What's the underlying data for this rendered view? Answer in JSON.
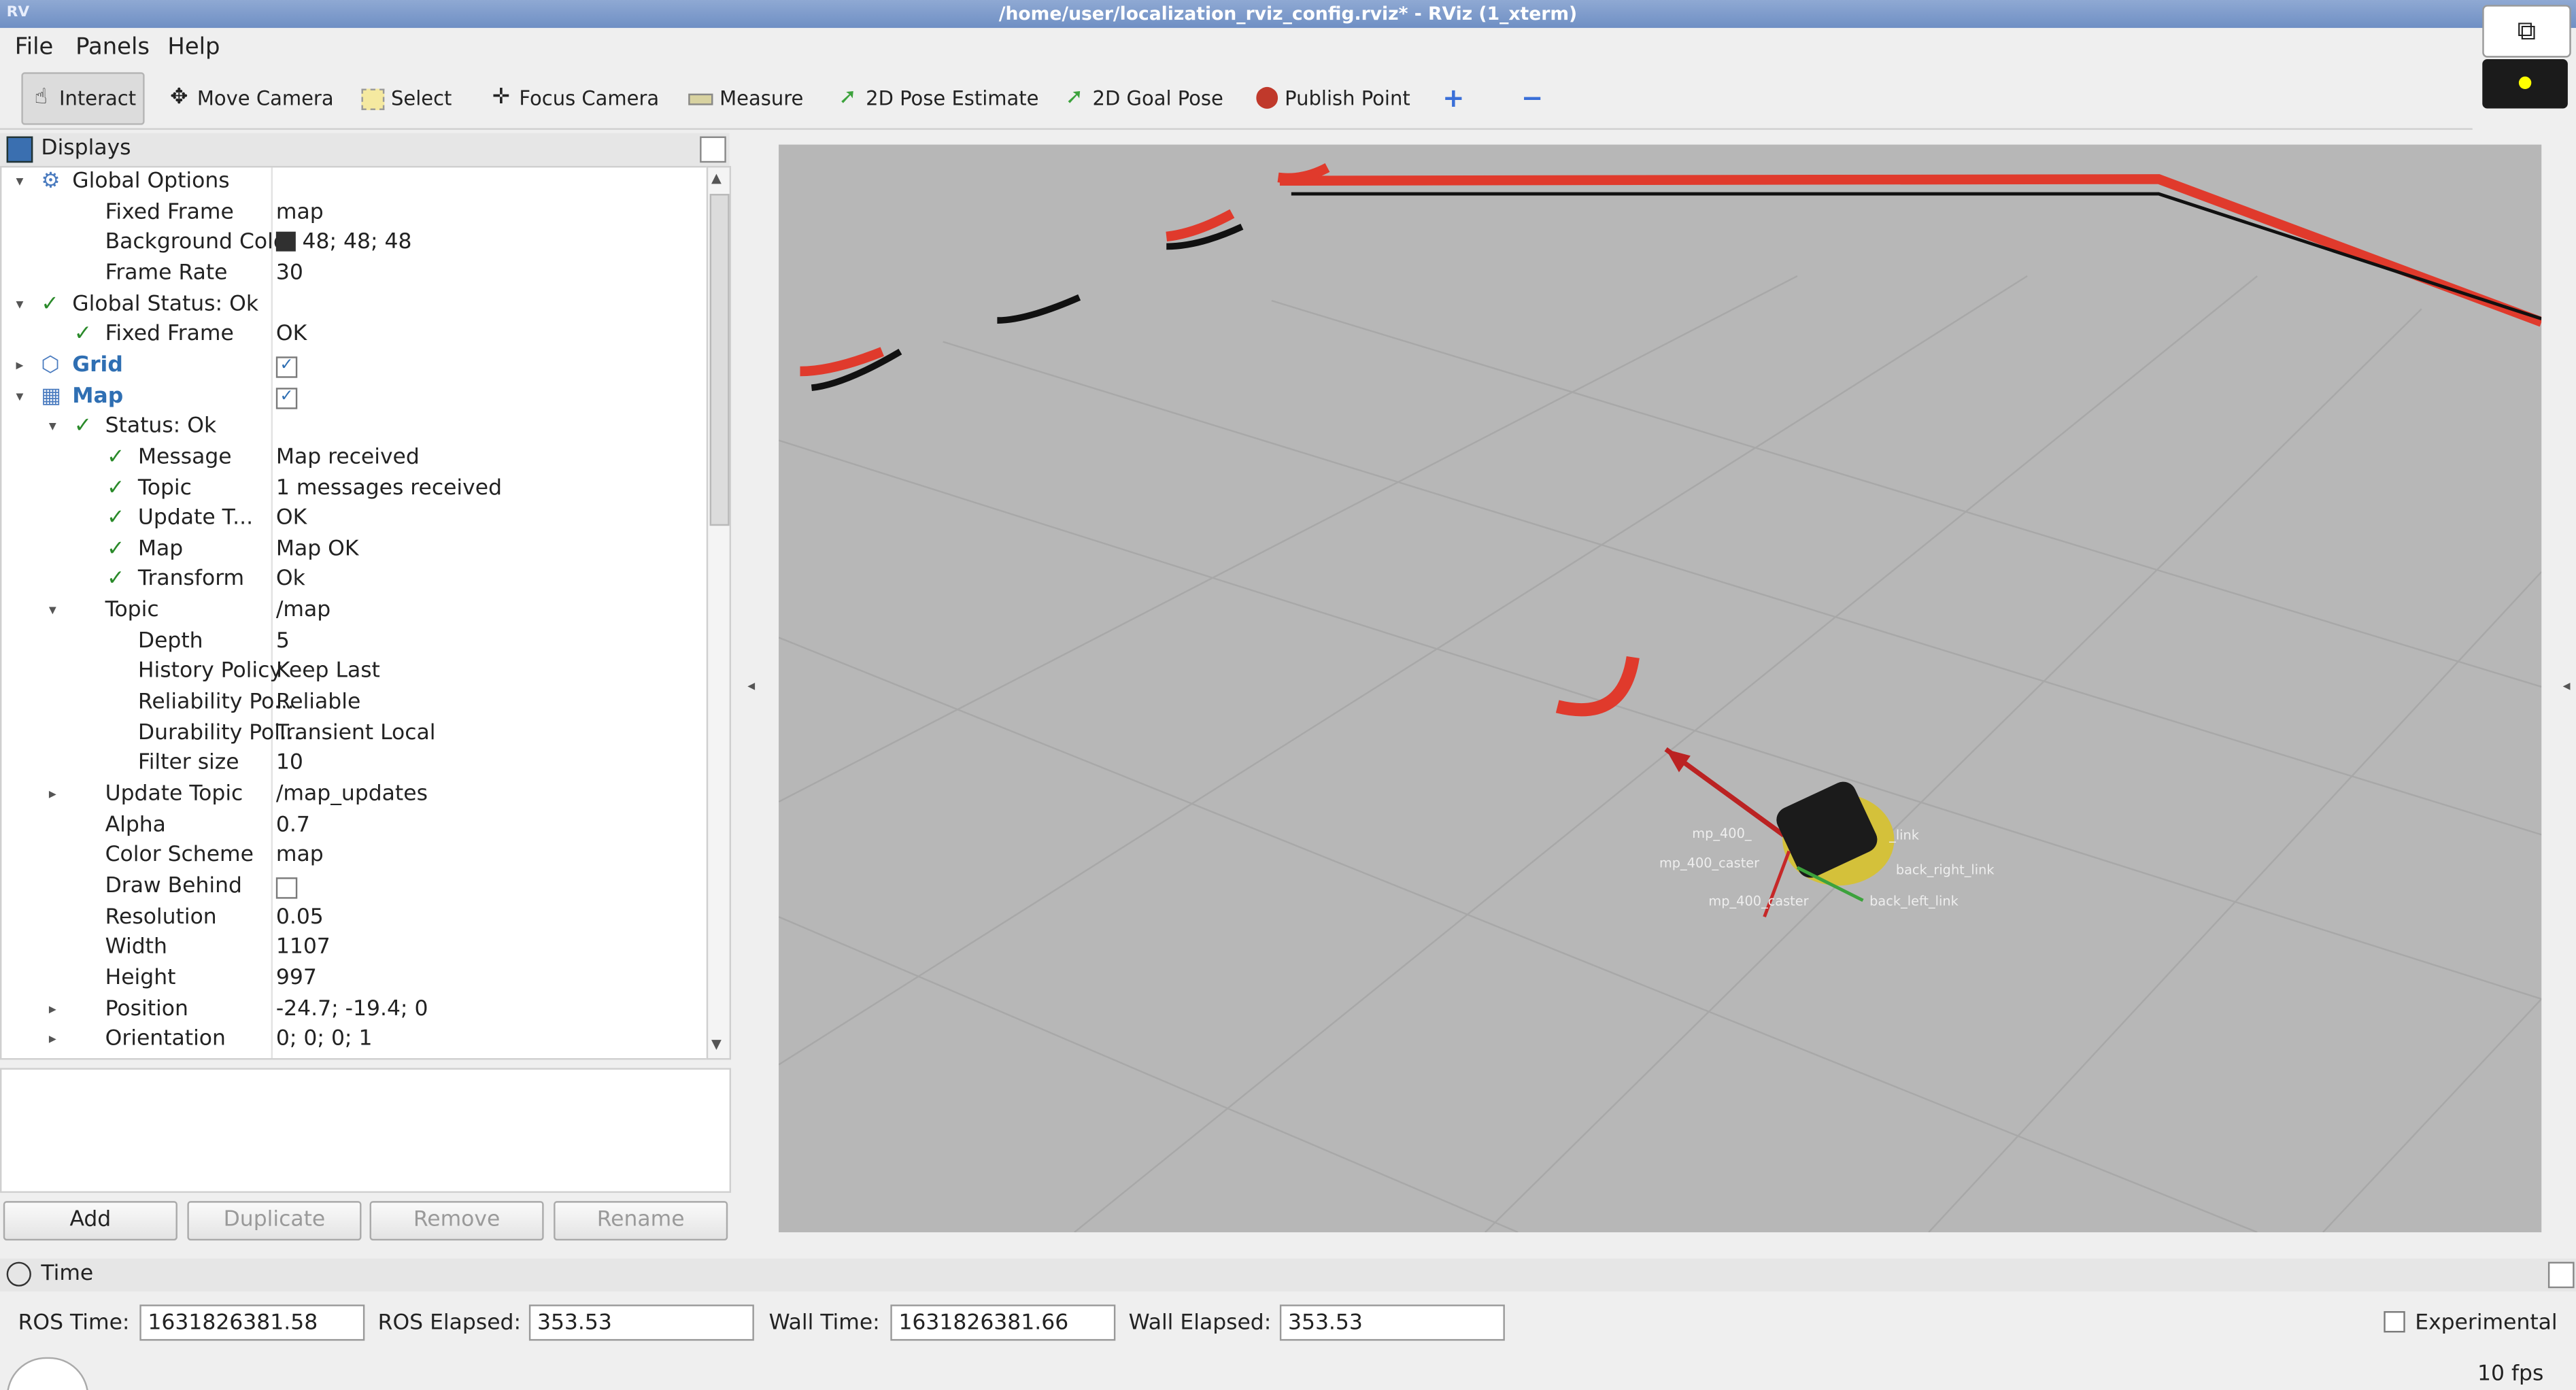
{
  "window": {
    "title": "/home/user/localization_rviz_config.rviz* - RViz (1_xterm)",
    "app_glyph": "RV"
  },
  "menu": [
    "File",
    "Panels",
    "Help"
  ],
  "toolbar": {
    "tools": [
      {
        "label": "Interact",
        "icon": "hand-icon"
      },
      {
        "label": "Move Camera",
        "icon": "move-camera-icon"
      },
      {
        "label": "Select",
        "icon": "select-icon"
      },
      {
        "label": "Focus Camera",
        "icon": "focus-camera-icon"
      },
      {
        "label": "Measure",
        "icon": "ruler-icon"
      },
      {
        "label": "2D Pose Estimate",
        "icon": "green-arrow-icon"
      },
      {
        "label": "2D Goal Pose",
        "icon": "green-arrow-icon"
      },
      {
        "label": "Publish Point",
        "icon": "map-pin-icon"
      }
    ],
    "add_symbol": "+",
    "remove_symbol": "−"
  },
  "displays": {
    "title": "Displays",
    "rows": [
      {
        "indent": 0,
        "arrow": "▾",
        "icon": "gear",
        "name": "Global Options",
        "value": ""
      },
      {
        "indent": 1,
        "name": "Fixed Frame",
        "value": "map"
      },
      {
        "indent": 1,
        "name": "Background Color",
        "value": "48; 48; 48",
        "swatch": "#303030"
      },
      {
        "indent": 1,
        "name": "Frame Rate",
        "value": "30"
      },
      {
        "indent": 0,
        "arrow": "▾",
        "check": true,
        "name": "Global Status: Ok",
        "value": ""
      },
      {
        "indent": 1,
        "check": true,
        "name": "Fixed Frame",
        "value": "OK"
      },
      {
        "indent": 0,
        "arrow": "▸",
        "icon": "grid",
        "name": "Grid",
        "value": "",
        "blue": true,
        "checkbox": true
      },
      {
        "indent": 0,
        "arrow": "▾",
        "icon": "map",
        "name": "Map",
        "value": "",
        "blue": true,
        "checkbox": true
      },
      {
        "indent": 1,
        "arrow": "▾",
        "check": true,
        "name": "Status: Ok",
        "value": ""
      },
      {
        "indent": 2,
        "check": true,
        "name": "Message",
        "value": "Map received"
      },
      {
        "indent": 2,
        "check": true,
        "name": "Topic",
        "value": "1 messages received"
      },
      {
        "indent": 2,
        "check": true,
        "name": "Update T...",
        "value": "OK"
      },
      {
        "indent": 2,
        "check": true,
        "name": "Map",
        "value": "Map OK"
      },
      {
        "indent": 2,
        "check": true,
        "name": "Transform",
        "value": "Ok"
      },
      {
        "indent": 1,
        "arrow": "▾",
        "name": "Topic",
        "value": "/map"
      },
      {
        "indent": 2,
        "name": "Depth",
        "value": "5"
      },
      {
        "indent": 2,
        "name": "History Policy",
        "value": "Keep Last"
      },
      {
        "indent": 2,
        "name": "Reliability Po...",
        "value": "Reliable"
      },
      {
        "indent": 2,
        "name": "Durability Pol...",
        "value": "Transient Local"
      },
      {
        "indent": 2,
        "name": "Filter size",
        "value": "10"
      },
      {
        "indent": 1,
        "arrow": "▸",
        "name": "Update Topic",
        "value": "/map_updates"
      },
      {
        "indent": 1,
        "name": "Alpha",
        "value": "0.7"
      },
      {
        "indent": 1,
        "name": "Color Scheme",
        "value": "map"
      },
      {
        "indent": 1,
        "name": "Draw Behind",
        "value": "",
        "emptybox": true
      },
      {
        "indent": 1,
        "name": "Resolution",
        "value": "0.05"
      },
      {
        "indent": 1,
        "name": "Width",
        "value": "1107"
      },
      {
        "indent": 1,
        "name": "Height",
        "value": "997"
      },
      {
        "indent": 1,
        "arrow": "▸",
        "name": "Position",
        "value": "-24.7; -19.4; 0"
      },
      {
        "indent": 1,
        "arrow": "▸",
        "name": "Orientation",
        "value": "0; 0; 0; 1"
      }
    ],
    "buttons": {
      "add": "Add",
      "duplicate": "Duplicate",
      "remove": "Remove",
      "rename": "Rename"
    }
  },
  "viewport": {
    "frame_labels": [
      "mp_400_caster",
      "mp_400_caster",
      "back_right_link",
      "back_left_link",
      "mp_400_",
      "_link"
    ]
  },
  "time": {
    "title": "Time",
    "ros_time_label": "ROS Time:",
    "ros_time": "1631826381.58",
    "ros_elapsed_label": "ROS Elapsed:",
    "ros_elapsed": "353.53",
    "wall_time_label": "Wall Time:",
    "wall_time": "1631826381.66",
    "wall_elapsed_label": "Wall Elapsed:",
    "wall_elapsed": "353.53",
    "experimental": "Experimental",
    "fps": "10 fps"
  },
  "colors": {
    "viewport_bg": "#b7b7b7",
    "laser": "#e03a2c",
    "map_wall": "#111111",
    "robot_body": "#d4c13a"
  }
}
